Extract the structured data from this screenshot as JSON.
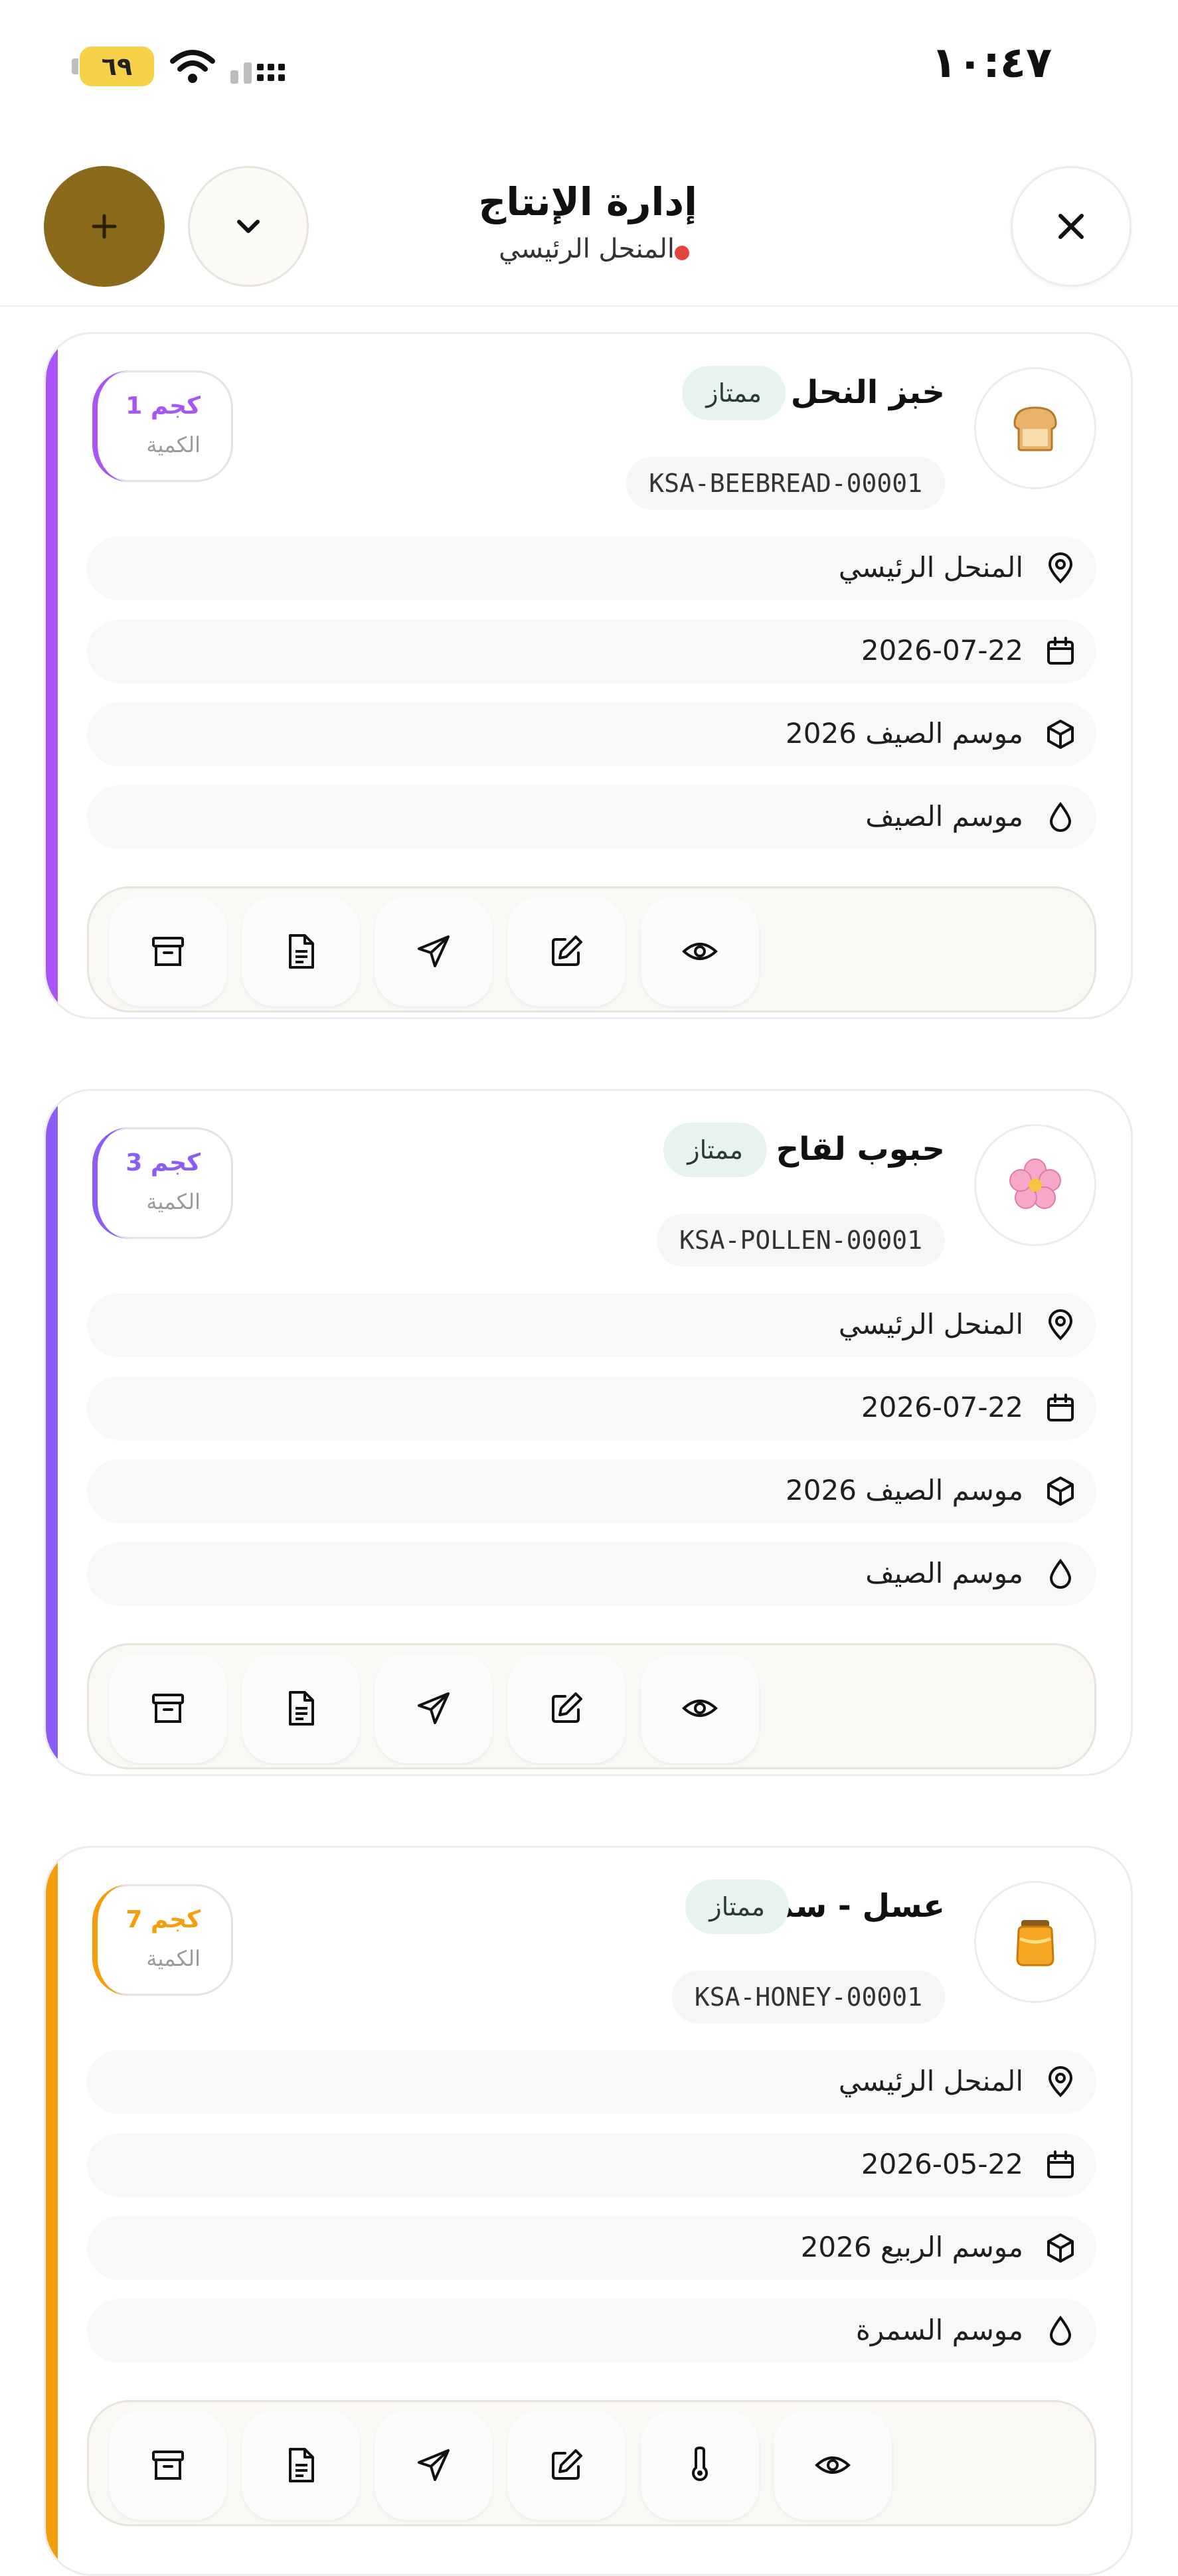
{
  "status_bar": {
    "time": "١٠:٤٧",
    "battery": "٦٩"
  },
  "header": {
    "title": "إدارة الإنتاج",
    "subtitle": "المنحل الرئيسي"
  },
  "colors": {
    "accent_gold": "#8a6a1a",
    "purple": "#a855f7",
    "violet": "#8b5cf6",
    "amber": "#f59e0b",
    "badge_bg": "#e7f4ee"
  },
  "products": [
    {
      "name": "خبز النحل",
      "badge": "ممتاز",
      "code": "KSA-BEEBREAD-00001",
      "icon": "bread-icon",
      "quantity": "1 كجم",
      "quantity_label": "الكمية",
      "location": "المنحل الرئيسي",
      "date": "2026-07-22",
      "batch": "موسم الصيف 2026",
      "season": "موسم الصيف",
      "actions": [
        "view-icon",
        "edit-icon",
        "send-icon",
        "document-icon",
        "archive-icon"
      ]
    },
    {
      "name": "حبوب لقاح",
      "badge": "ممتاز",
      "code": "KSA-POLLEN-00001",
      "icon": "flower-icon",
      "quantity": "3 كجم",
      "quantity_label": "الكمية",
      "location": "المنحل الرئيسي",
      "date": "2026-07-22",
      "batch": "موسم الصيف 2026",
      "season": "موسم الصيف",
      "actions": [
        "view-icon",
        "edit-icon",
        "send-icon",
        "document-icon",
        "archive-icon"
      ]
    },
    {
      "name": "عسل - سمر",
      "badge": "ممتاز",
      "code": "KSA-HONEY-00001",
      "icon": "honey-jar-icon",
      "quantity": "7 كجم",
      "quantity_label": "الكمية",
      "location": "المنحل الرئيسي",
      "date": "2026-05-22",
      "batch": "موسم الربيع 2026",
      "season": "موسم السمرة",
      "actions": [
        "view-icon",
        "thermometer-icon",
        "edit-icon",
        "send-icon",
        "document-icon",
        "archive-icon"
      ]
    }
  ]
}
